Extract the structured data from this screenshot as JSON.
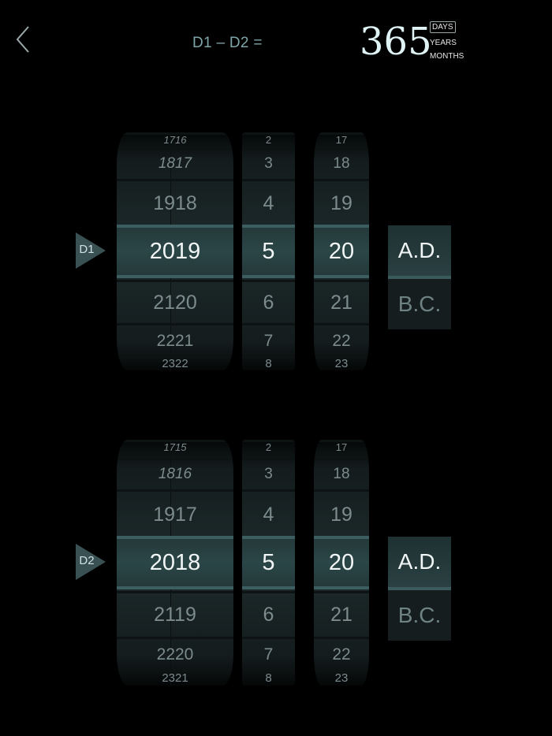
{
  "header": {
    "formula": "D1 – D2 =",
    "result_value": "365",
    "units": [
      "DAYS",
      "YEARS",
      "MONTHS"
    ],
    "active_unit": "DAYS"
  },
  "colors": {
    "accent": "#3c5e60",
    "selected_bg": "#2b4647",
    "text_dim": "#7c8b8c"
  },
  "icons": {
    "back": "chevron-left-icon",
    "marker": "triangle-right-icon"
  },
  "d1": {
    "label": "D1",
    "years": [
      "1716",
      "1817",
      "1918",
      "2019",
      "2120",
      "2221",
      "2322"
    ],
    "months": [
      "2",
      "3",
      "4",
      "5",
      "6",
      "7",
      "8"
    ],
    "days": [
      "17",
      "18",
      "19",
      "20",
      "21",
      "22",
      "23"
    ],
    "era_options": [
      "A.D.",
      "B.C."
    ],
    "era_selected": "A.D."
  },
  "d2": {
    "label": "D2",
    "years": [
      "1715",
      "1816",
      "1917",
      "2018",
      "2119",
      "2220",
      "2321"
    ],
    "months": [
      "2",
      "3",
      "4",
      "5",
      "6",
      "7",
      "8"
    ],
    "days": [
      "17",
      "18",
      "19",
      "20",
      "21",
      "22",
      "23"
    ],
    "era_options": [
      "A.D.",
      "B.C."
    ],
    "era_selected": "A.D."
  }
}
